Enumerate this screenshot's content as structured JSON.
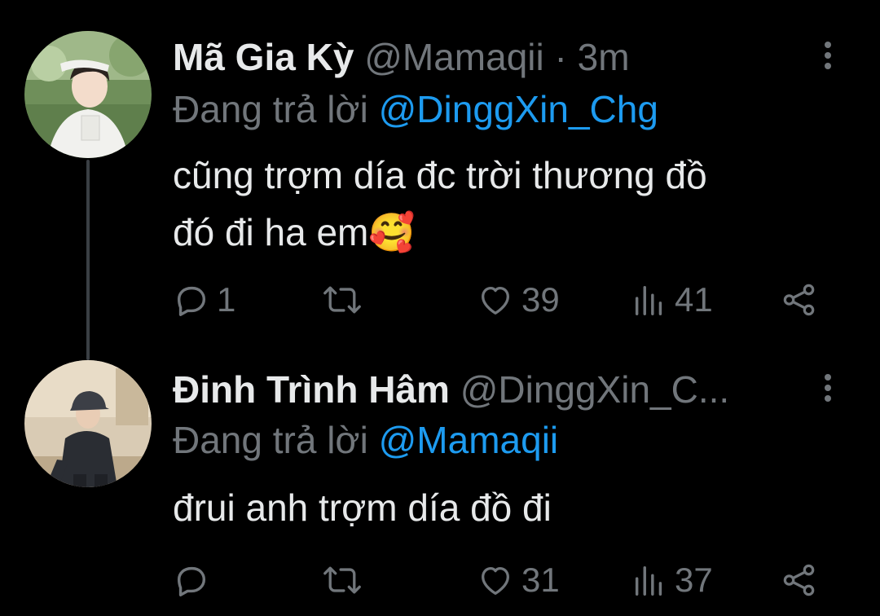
{
  "tweets": [
    {
      "display_name": "Mã Gia Kỳ",
      "handle": "@Mamaqii",
      "separator": "·",
      "time": "3m",
      "reply_prefix": "Đang trả lời",
      "reply_to": "@DinggXin_Chg",
      "text_line1": "cũng trợm día đc trời thương đồ",
      "text_line2": "đó đi ha em",
      "emoji": "🥰",
      "counts": {
        "replies": "1",
        "retweets": "",
        "likes": "39",
        "views": "41"
      }
    },
    {
      "display_name": "Đinh Trình Hâm",
      "handle": "@DinggXin_C...",
      "reply_prefix": "Đang trả lời",
      "reply_to": "@Mamaqii",
      "text_line1": "đrui anh trợm día đồ đi",
      "counts": {
        "replies": "",
        "retweets": "",
        "likes": "31",
        "views": "37"
      }
    }
  ],
  "colors": {
    "background": "#000000",
    "text": "#e7e9ea",
    "secondary": "#71767b",
    "mention": "#1d9bf0",
    "thread_line": "#3a3f44"
  },
  "icons": [
    "reply-icon",
    "retweet-icon",
    "like-icon",
    "views-icon",
    "share-icon",
    "more-options-icon"
  ]
}
